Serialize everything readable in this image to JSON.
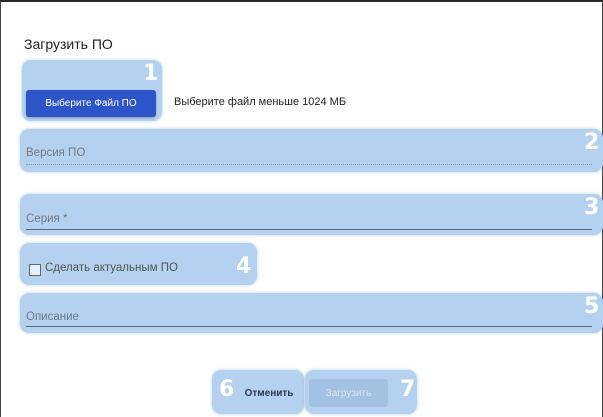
{
  "dialog": {
    "title": "Загрузить ПО",
    "file_button_label": "Выберите Файл ПО",
    "file_hint": "Выберите файл меньше 1024 МБ",
    "version_label": "Версия ПО",
    "series_label": "Серия *",
    "actual_checkbox_label": "Сделать актуальным ПО",
    "actual_checkbox_checked": false,
    "description_label": "Описание",
    "cancel_label": "Отменить",
    "upload_label": "Загрузить",
    "upload_disabled": true
  },
  "markers": [
    "1",
    "2",
    "3",
    "4",
    "5",
    "6",
    "7"
  ],
  "colors": {
    "primary_button": "#2d55c8",
    "highlight": "#b4d2f0",
    "disabled_button": "#a3c1e1"
  }
}
